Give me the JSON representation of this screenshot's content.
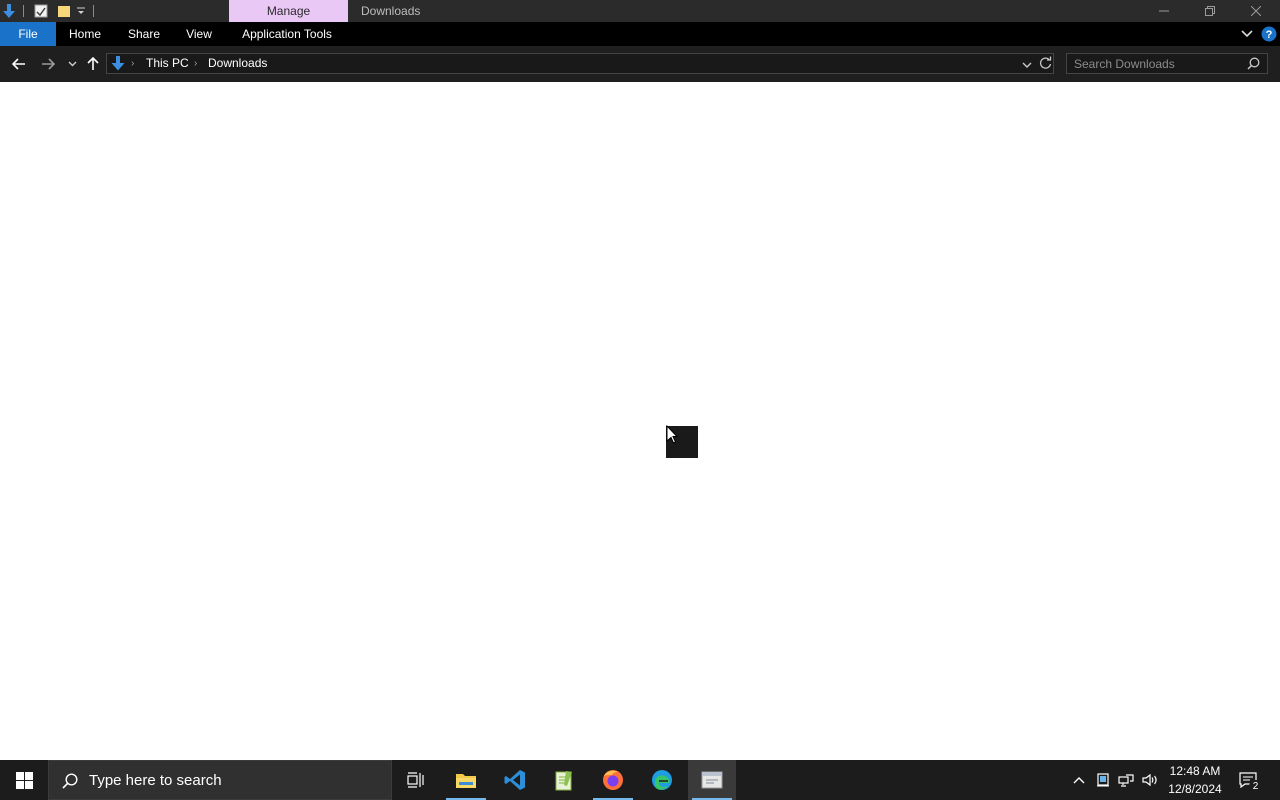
{
  "titlebar": {
    "context_tab": "Manage",
    "window_title": "Downloads",
    "colors": {
      "context_tab_bg": "#e9c8f6",
      "bar_bg": "#2b2b2b"
    },
    "quick_access_icons": [
      "downloads-arrow-icon",
      "properties-icon",
      "new-folder-icon",
      "customize-dropdown-icon"
    ],
    "controls": [
      "minimize-icon",
      "restore-icon",
      "close-icon"
    ]
  },
  "ribbon": {
    "tabs": [
      {
        "label": "File"
      },
      {
        "label": "Home"
      },
      {
        "label": "Share"
      },
      {
        "label": "View"
      },
      {
        "label": "Application Tools"
      }
    ],
    "accent": "#1a73c8"
  },
  "address_bar": {
    "breadcrumb": [
      "This PC",
      "Downloads"
    ],
    "search_placeholder": "Search Downloads"
  },
  "taskbar": {
    "search_placeholder": "Type here to search",
    "apps": [
      "task-view",
      "file-explorer",
      "vs-code",
      "notepad-plus-plus",
      "firefox",
      "edge",
      "active-window"
    ],
    "clock": {
      "time": "12:48 AM",
      "date": "12/8/2024"
    },
    "notification_count": "2"
  }
}
